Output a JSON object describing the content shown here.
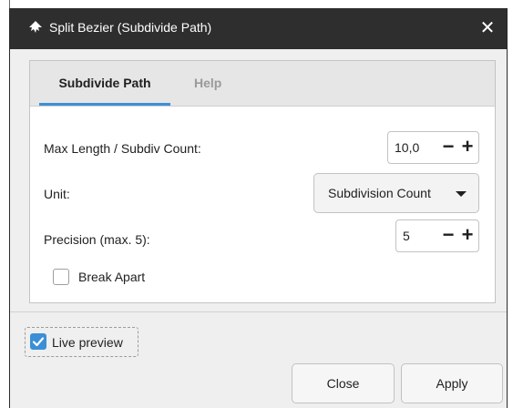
{
  "window": {
    "title": "Split Bezier (Subdivide Path)",
    "close_glyph": "✕",
    "app_icon": "inkscape-icon"
  },
  "tabs": [
    {
      "label": "Subdivide Path",
      "active": true
    },
    {
      "label": "Help",
      "active": false
    }
  ],
  "form": {
    "max_length": {
      "label": "Max Length / Subdiv Count:",
      "value": "10,0",
      "minus": "−",
      "plus": "+"
    },
    "unit": {
      "label": "Unit:",
      "selected": "Subdivision Count"
    },
    "precision": {
      "label": "Precision (max. 5):",
      "value": "5",
      "minus": "−",
      "plus": "+"
    },
    "break_apart": {
      "label": "Break Apart",
      "checked": false
    }
  },
  "footer": {
    "live_preview": {
      "label": "Live preview",
      "checked": true
    },
    "close_label": "Close",
    "apply_label": "Apply"
  },
  "colors": {
    "accent": "#3c8fd6",
    "titlebar": "#2e2e2e"
  }
}
